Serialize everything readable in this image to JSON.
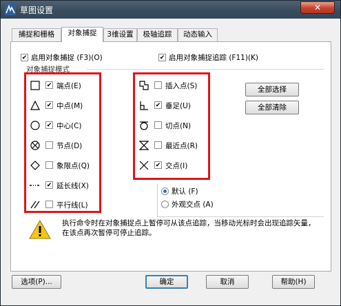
{
  "window": {
    "title": "草图设置",
    "close_label": "✕"
  },
  "tabs": [
    {
      "label": "捕捉和栅格",
      "active": false
    },
    {
      "label": "对象捕捉",
      "active": true
    },
    {
      "label": "3维设置",
      "active": false
    },
    {
      "label": "极轴追踪",
      "active": false
    },
    {
      "label": "动态输入",
      "active": false
    }
  ],
  "options": {
    "enable_snap": {
      "label": "启用对象捕捉 (F3)(O)",
      "checked": true
    },
    "enable_tracking": {
      "label": "启用对象捕捉追踪 (F11)(K)",
      "checked": true
    }
  },
  "group_label": "对象捕捉模式",
  "snap_modes_left": [
    {
      "label": "端点(E)",
      "checked": true,
      "icon": "square-endpoint-icon"
    },
    {
      "label": "中点(M)",
      "checked": true,
      "icon": "triangle-midpoint-icon"
    },
    {
      "label": "中心(C)",
      "checked": true,
      "icon": "circle-center-icon"
    },
    {
      "label": "节点(D)",
      "checked": false,
      "icon": "node-icon"
    },
    {
      "label": "象限点(Q)",
      "checked": false,
      "icon": "diamond-quadrant-icon"
    },
    {
      "label": "延长线(X)",
      "checked": true,
      "icon": "extension-icon"
    },
    {
      "label": "平行线(L)",
      "checked": false,
      "icon": "parallel-icon"
    }
  ],
  "snap_modes_right": [
    {
      "label": "插入点(S)",
      "checked": false,
      "icon": "insertion-icon"
    },
    {
      "label": "垂足(U)",
      "checked": true,
      "icon": "perpendicular-icon"
    },
    {
      "label": "切点(N)",
      "checked": false,
      "icon": "tangent-icon"
    },
    {
      "label": "最近点(R)",
      "checked": false,
      "icon": "nearest-icon"
    },
    {
      "label": "交点(I)",
      "checked": true,
      "icon": "intersection-icon"
    }
  ],
  "buttons": {
    "select_all": "全部选择",
    "clear_all": "全部清除",
    "options": "选项(P)...",
    "ok": "确定",
    "cancel": "取消",
    "help": "帮助(H)"
  },
  "radio": [
    {
      "label": "默认 (F)",
      "selected": true
    },
    {
      "label": "外观交点 (A)",
      "selected": false
    }
  ],
  "warning": {
    "text": "执行命令时在对象捕捉点上暂停可从该点追踪，当移动光标时会出现追踪矢量，在该点再次暂停可停止追踪。"
  },
  "colors": {
    "highlight_box": "#e0141b",
    "title_bar": "#3a4d5e",
    "close_button": "#c5422d",
    "default_button_border": "#3c7fb1"
  }
}
